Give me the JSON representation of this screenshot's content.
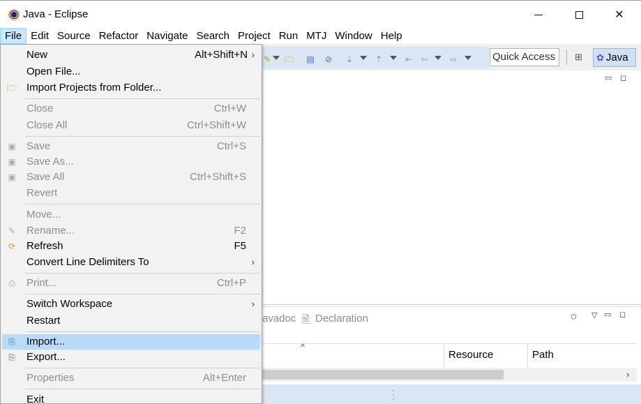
{
  "window": {
    "title": "Java - Eclipse"
  },
  "menubar": [
    "File",
    "Edit",
    "Source",
    "Refactor",
    "Navigate",
    "Search",
    "Project",
    "Run",
    "MTJ",
    "Window",
    "Help"
  ],
  "toolbar": {
    "quick_access_placeholder": "Quick Access",
    "perspective": "Java"
  },
  "file_menu": {
    "new": {
      "label": "New",
      "accel": "Alt+Shift+N"
    },
    "open_file": {
      "label": "Open File..."
    },
    "import_projects": {
      "label": "Import Projects from Folder..."
    },
    "close": {
      "label": "Close",
      "accel": "Ctrl+W"
    },
    "close_all": {
      "label": "Close All",
      "accel": "Ctrl+Shift+W"
    },
    "save": {
      "label": "Save",
      "accel": "Ctrl+S"
    },
    "save_as": {
      "label": "Save As..."
    },
    "save_all": {
      "label": "Save All",
      "accel": "Ctrl+Shift+S"
    },
    "revert": {
      "label": "Revert"
    },
    "move": {
      "label": "Move..."
    },
    "rename": {
      "label": "Rename...",
      "accel": "F2"
    },
    "refresh": {
      "label": "Refresh",
      "accel": "F5"
    },
    "convert": {
      "label": "Convert Line Delimiters To"
    },
    "print": {
      "label": "Print...",
      "accel": "Ctrl+P"
    },
    "switch_workspace": {
      "label": "Switch Workspace"
    },
    "restart": {
      "label": "Restart"
    },
    "import": {
      "label": "Import..."
    },
    "export": {
      "label": "Export..."
    },
    "properties": {
      "label": "Properties",
      "accel": "Alt+Enter"
    },
    "exit": {
      "label": "Exit"
    }
  },
  "bottom_view": {
    "tabs": [
      "avadoc",
      "Declaration"
    ],
    "columns": [
      "Resource",
      "Path"
    ]
  },
  "colors": {
    "menu_highlight": "#b9dbf8",
    "active_menu": "#cce8ff",
    "toolbar_strip": "#dbe6f4"
  }
}
